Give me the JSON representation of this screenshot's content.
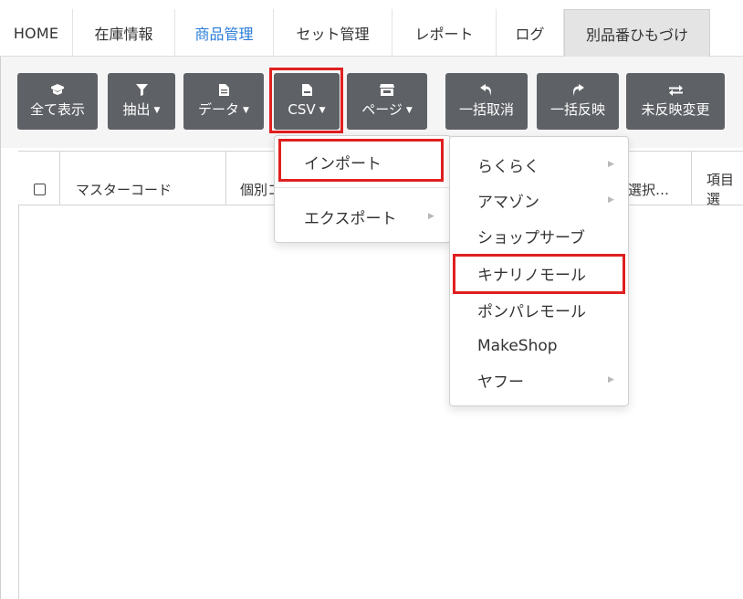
{
  "nav": {
    "items": [
      {
        "label": "HOME"
      },
      {
        "label": "在庫情報"
      },
      {
        "label": "商品管理"
      },
      {
        "label": "セット管理"
      },
      {
        "label": "レポート"
      },
      {
        "label": "ログ"
      },
      {
        "label": "別品番ひもづけ"
      }
    ],
    "active_index": 2
  },
  "toolbar": {
    "buttons": [
      {
        "label": "全て表示",
        "icon": "box-icon"
      },
      {
        "label": "抽出",
        "icon": "filter-icon",
        "dropdown": true
      },
      {
        "label": "データ",
        "icon": "file-icon",
        "dropdown": true
      },
      {
        "label": "CSV",
        "icon": "csv-file-icon",
        "dropdown": true
      },
      {
        "label": "ページ",
        "icon": "store-icon",
        "dropdown": true
      },
      {
        "label": "一括取消",
        "icon": "undo-icon"
      },
      {
        "label": "一括反映",
        "icon": "redo-icon"
      },
      {
        "label": "未反映変更",
        "icon": "swap-icon"
      }
    ]
  },
  "table": {
    "columns": [
      "マスターコード",
      "個別コ",
      "選択…",
      "項目選"
    ]
  },
  "csv_menu": {
    "items": [
      {
        "label": "インポート",
        "highlighted": true
      },
      {
        "label": "エクスポート",
        "has_submenu": true
      }
    ]
  },
  "import_submenu": {
    "items": [
      {
        "label": "らくらく",
        "has_submenu": true
      },
      {
        "label": "アマゾン",
        "has_submenu": true
      },
      {
        "label": "ショップサーブ"
      },
      {
        "label": "キナリノモール",
        "highlighted": true
      },
      {
        "label": "ポンパレモール"
      },
      {
        "label": "MakeShop"
      },
      {
        "label": "ヤフー",
        "has_submenu": true
      }
    ]
  },
  "colors": {
    "button_bg": "#5e6166",
    "active_nav": "#2a7bd8",
    "highlight": "#e01f1f"
  }
}
